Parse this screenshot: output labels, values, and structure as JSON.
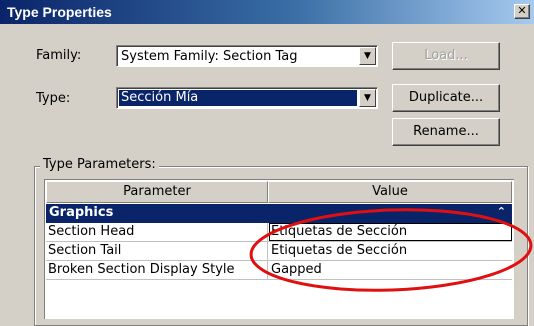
{
  "window": {
    "title": "Type Properties",
    "close_glyph": "✕"
  },
  "form": {
    "family_label": "Family:",
    "family_value": "System Family: Section Tag",
    "type_label": "Type:",
    "type_value": "Sección Mía"
  },
  "buttons": {
    "load": "Load...",
    "duplicate": "Duplicate...",
    "rename": "Rename..."
  },
  "type_parameters": {
    "group_label": "Type Parameters:",
    "columns": [
      "Parameter",
      "Value"
    ],
    "category": {
      "label": "Graphics",
      "collapse_glyph": "⌃"
    },
    "rows": [
      {
        "parameter": "Section Head",
        "value": "Etiquetas de Sección"
      },
      {
        "parameter": "Section Tail",
        "value": "Etiquetas de Sección"
      },
      {
        "parameter": "Broken Section Display Style",
        "value": "Gapped"
      }
    ]
  },
  "colors": {
    "title_bar": "#0a246a",
    "selection": "#0a246a",
    "annotation_ellipse": "#e01010",
    "dialog_face": "#d4d0c8"
  }
}
